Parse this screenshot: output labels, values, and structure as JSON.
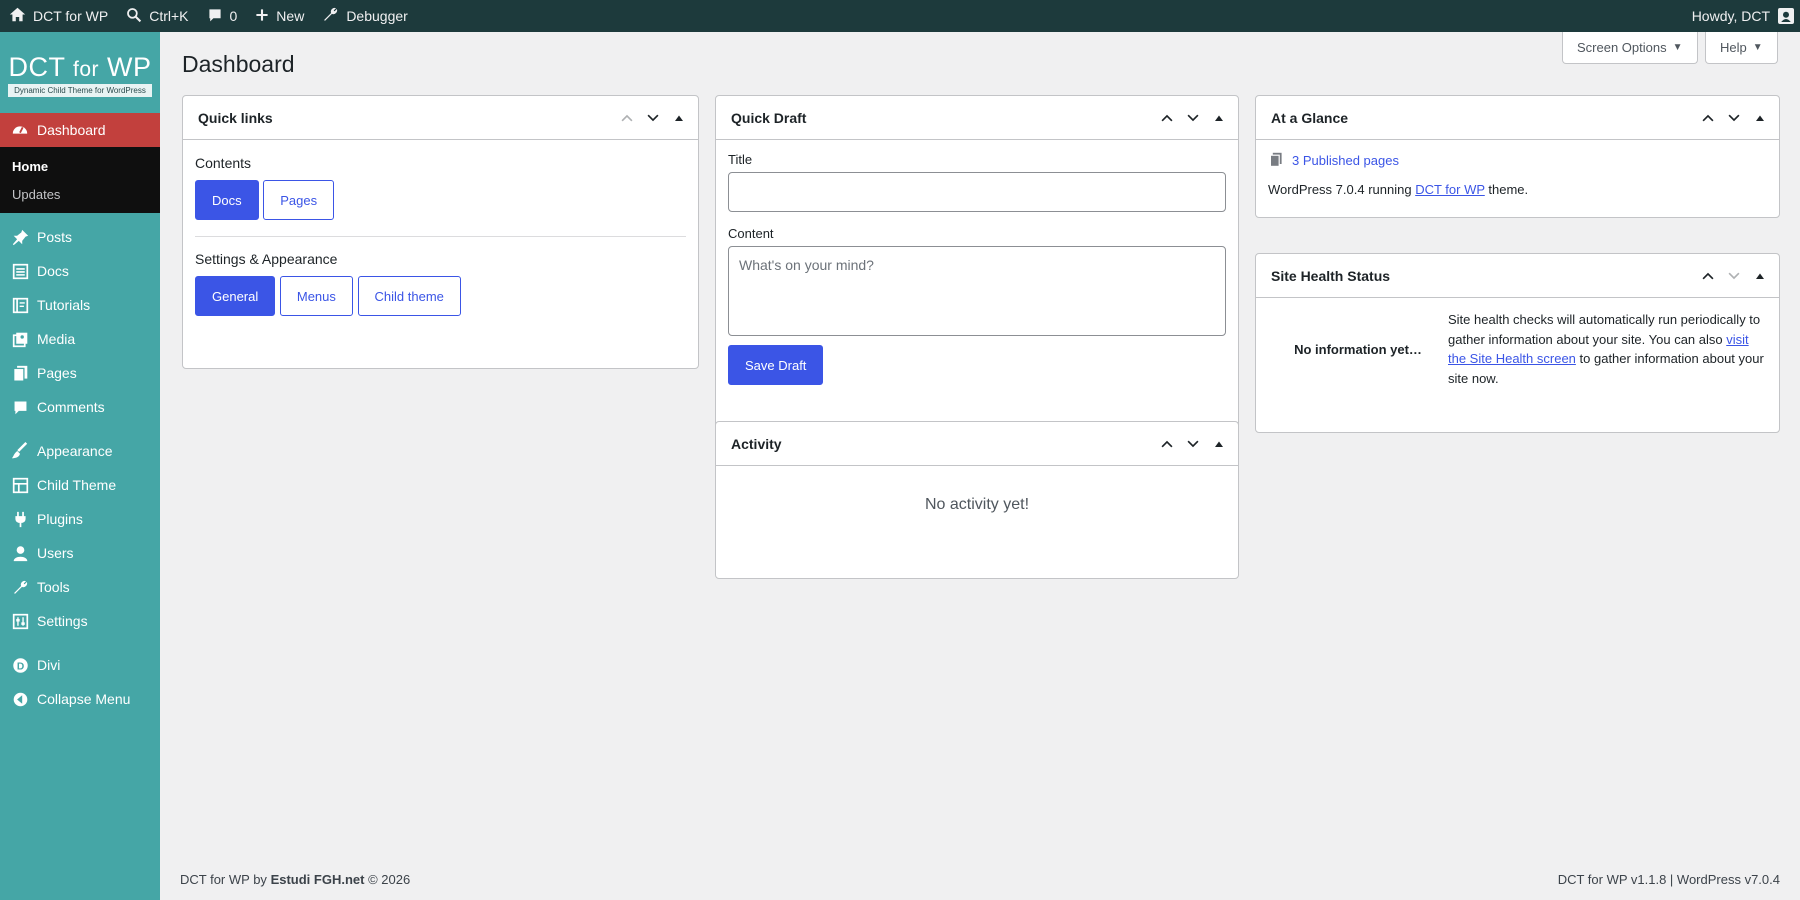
{
  "adminbar": {
    "site_name": "DCT for WP",
    "search_shortcut": "Ctrl+K",
    "comments_count": "0",
    "new_label": "New",
    "debugger_label": "Debugger",
    "howdy": "Howdy, DCT"
  },
  "logo": {
    "title_main": "DCT",
    "title_for": "for",
    "title_wp": "WP",
    "subtitle": "Dynamic Child Theme for WordPress"
  },
  "sidebar": {
    "current": {
      "label": "Dashboard",
      "icon": "dashboard-icon"
    },
    "submenu": [
      {
        "label": "Home",
        "active": true
      },
      {
        "label": "Updates",
        "active": false
      }
    ],
    "items": [
      {
        "label": "Posts",
        "icon": "pin-icon"
      },
      {
        "label": "Docs",
        "icon": "list-icon"
      },
      {
        "label": "Tutorials",
        "icon": "book-icon"
      },
      {
        "label": "Media",
        "icon": "media-icon"
      },
      {
        "label": "Pages",
        "icon": "pages-icon"
      },
      {
        "label": "Comments",
        "icon": "comment-icon"
      },
      {
        "label": "Appearance",
        "icon": "brush-icon"
      },
      {
        "label": "Child Theme",
        "icon": "grid-icon"
      },
      {
        "label": "Plugins",
        "icon": "plugin-icon"
      },
      {
        "label": "Users",
        "icon": "user-icon"
      },
      {
        "label": "Tools",
        "icon": "wrench-icon"
      },
      {
        "label": "Settings",
        "icon": "sliders-icon"
      },
      {
        "label": "Divi",
        "icon": "divi-icon"
      },
      {
        "label": "Collapse Menu",
        "icon": "collapse-icon"
      }
    ]
  },
  "page": {
    "title": "Dashboard",
    "screen_options": "Screen Options",
    "help": "Help"
  },
  "quick_links": {
    "title": "Quick links",
    "contents_label": "Contents",
    "docs": "Docs",
    "pages": "Pages",
    "settings_label": "Settings & Appearance",
    "general": "General",
    "menus": "Menus",
    "child_theme": "Child theme"
  },
  "quick_draft": {
    "title": "Quick Draft",
    "title_label": "Title",
    "title_value": "",
    "content_label": "Content",
    "content_placeholder": "What's on your mind?",
    "save": "Save Draft"
  },
  "activity": {
    "title": "Activity",
    "empty": "No activity yet!"
  },
  "glance": {
    "title": "At a Glance",
    "published": "3 Published pages",
    "running_prefix": "WordPress 7.0.4 running",
    "theme_link": "DCT for WP",
    "running_suffix": "theme."
  },
  "site_health": {
    "title": "Site Health Status",
    "no_info": "No information yet…",
    "text_1": "Site health checks will automatically run periodically to gather information about your site. You can also",
    "link": "visit the Site Health screen",
    "text_2": "to gather information about your site now."
  },
  "footer": {
    "left_prefix": "DCT for WP by",
    "left_author": "Estudi FGH.net",
    "left_suffix": "© 2026",
    "right": "DCT for WP v1.1.8 | WordPress v7.0.4"
  },
  "colors": {
    "sidebar": "#45a6a6",
    "adminbar": "#1d3a3c",
    "current_menu": "#c2403d",
    "accent": "#3b55e6"
  }
}
